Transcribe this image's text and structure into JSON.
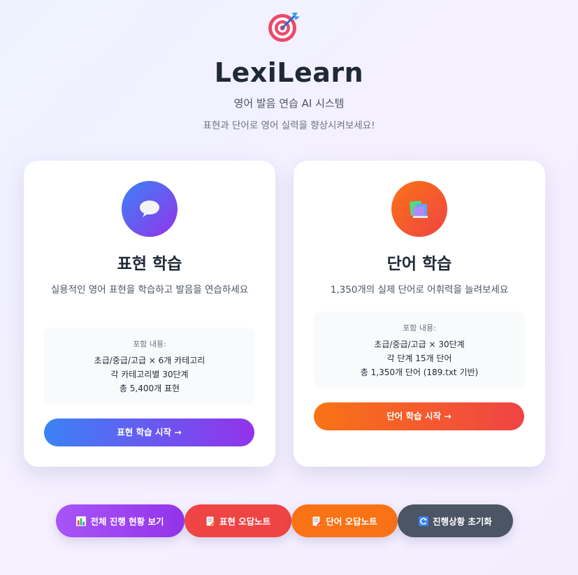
{
  "header": {
    "app_title": "LexiLearn",
    "subtitle": "영어 발음 연습 AI 시스템",
    "tagline": "표현과 단어로 영어 실력을 향상시켜보세요!",
    "logo_icon": "target-dart-icon"
  },
  "cards": {
    "expression": {
      "icon": "speech-bubble-icon",
      "title": "표현 학습",
      "description": "실용적인 영어 표현을 학습하고 발음을 연습하세요",
      "info_label": "포함 내용:",
      "info_lines": [
        "초급/중급/고급 × 6개 카테고리",
        "각 카테고리별 30단계",
        "총 5,400개 표현"
      ],
      "button_label": "표현 학습 시작 →"
    },
    "word": {
      "icon": "books-icon",
      "title": "단어 학습",
      "description": "1,350개의 실제 단어로 어휘력을 늘려보세요",
      "info_label": "포함 내용:",
      "info_lines": [
        "초급/중급/고급 × 30단계",
        "각 단계 15개 단어",
        "총 1,350개 단어 (189.txt 기반)"
      ],
      "button_label": "단어 학습 시작 →"
    }
  },
  "bottom_buttons": {
    "progress": {
      "label": "전체 진행 현황 보기",
      "icon": "bar-chart-icon"
    },
    "expression_notes": {
      "label": "표현 오답노트",
      "icon": "memo-icon"
    },
    "word_notes": {
      "label": "단어 오답노트",
      "icon": "memo-icon"
    },
    "reset": {
      "label": "진행상황 초기화",
      "icon": "refresh-icon"
    }
  },
  "colors": {
    "expression_gradient": [
      "#3b82f6",
      "#9333ea"
    ],
    "word_gradient": [
      "#f97316",
      "#ef4444"
    ],
    "progress_button": "#a855f7",
    "expression_notes_button": "#ef4444",
    "word_notes_button": "#f97316",
    "reset_button": "#4b5563"
  }
}
